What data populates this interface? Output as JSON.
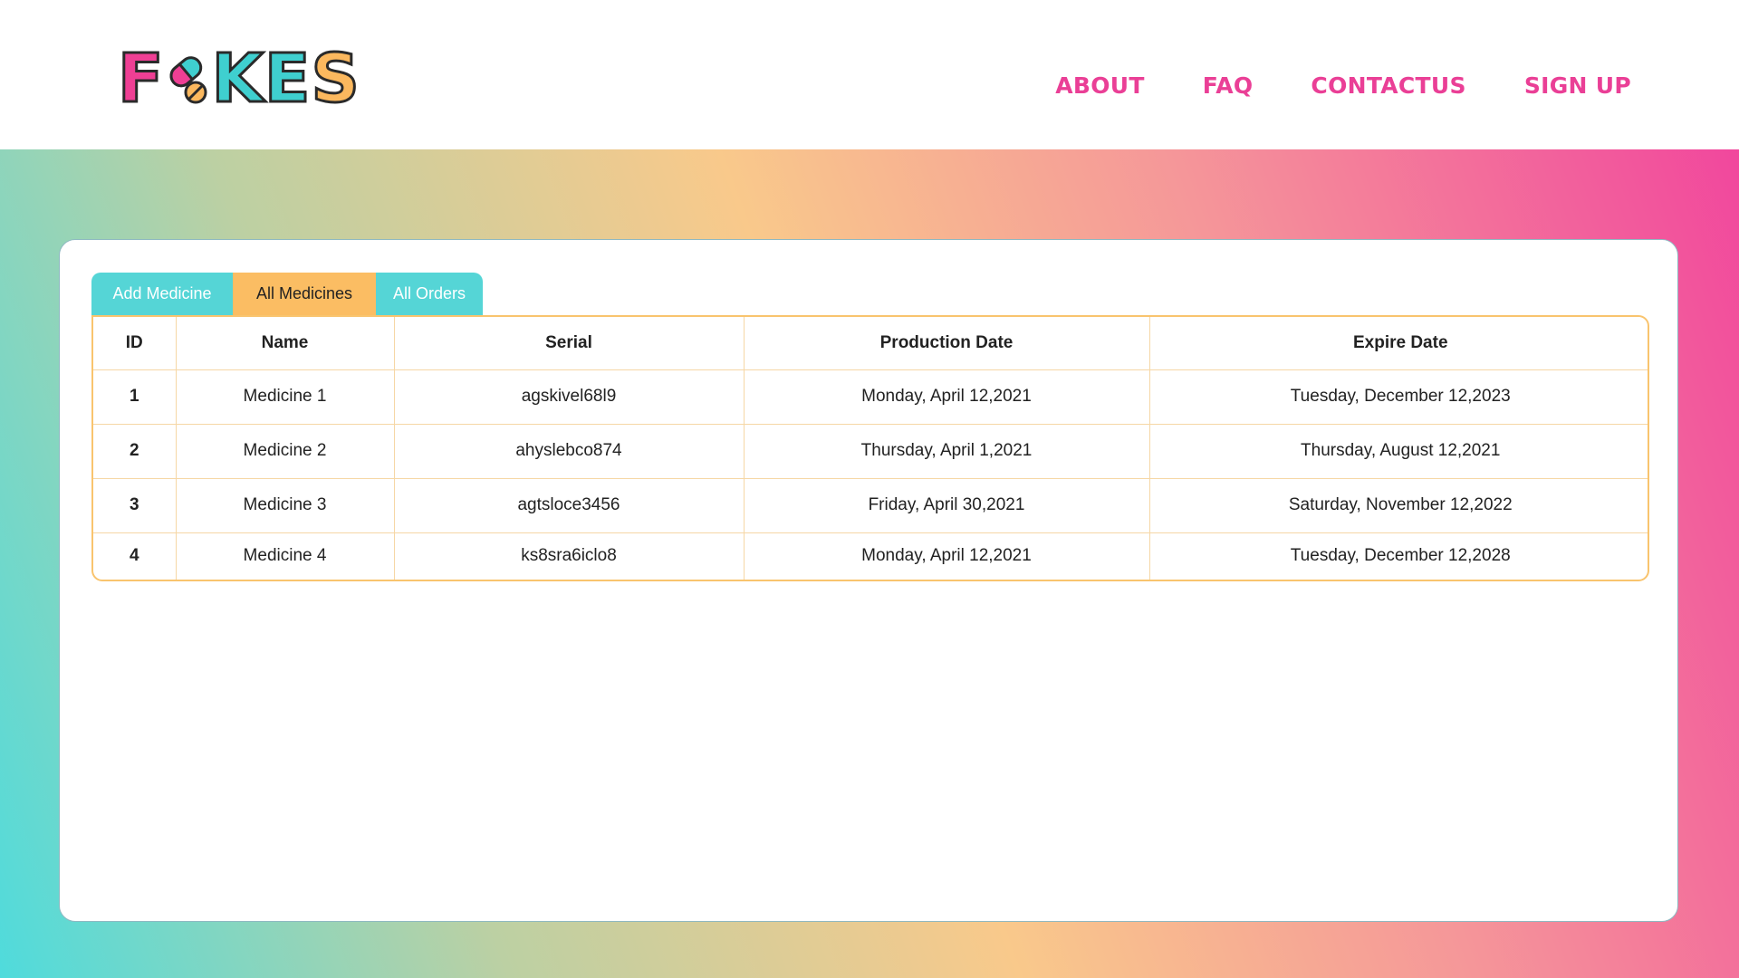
{
  "brand": {
    "logo_text": "FAKES"
  },
  "nav": {
    "items": [
      "ABOUT",
      "FAQ",
      "CONTACTUS",
      "SIGN UP"
    ]
  },
  "tabs": [
    {
      "label": "Add Medicine",
      "active": false
    },
    {
      "label": "All Medicines",
      "active": true
    },
    {
      "label": "All Orders",
      "active": false
    }
  ],
  "table": {
    "headers": [
      "ID",
      "Name",
      "Serial",
      "Production Date",
      "Expire Date"
    ],
    "rows": [
      [
        "1",
        "Medicine 1",
        "agskivel68l9",
        "Monday, April 12,2021",
        "Tuesday, December 12,2023"
      ],
      [
        "2",
        "Medicine 2",
        "ahyslebco874",
        "Thursday, April 1,2021",
        "Thursday, August 12,2021"
      ],
      [
        "3",
        "Medicine 3",
        "agtsloce3456",
        "Friday, April 30,2021",
        "Saturday, November 12,2022"
      ],
      [
        "4",
        "Medicine 4",
        "ks8sra6iclo8",
        "Monday, April 12,2021",
        "Tuesday, December 12,2028"
      ]
    ]
  },
  "colors": {
    "accent_pink": "#ea3f96",
    "accent_teal": "#55d5d6",
    "accent_orange": "#fbbd63",
    "table_border": "#f9c46e"
  }
}
